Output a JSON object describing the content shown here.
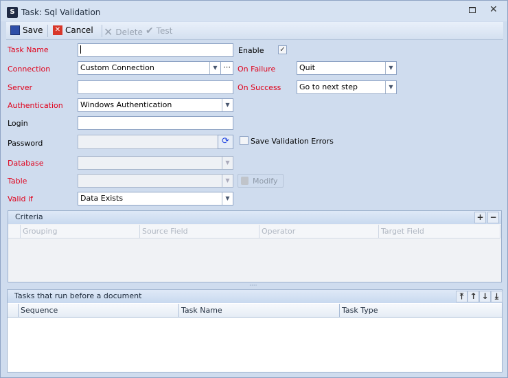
{
  "window": {
    "title": "Task: Sql Validation",
    "icon": "app-logo-icon"
  },
  "toolbar": {
    "save": "Save",
    "cancel": "Cancel",
    "delete": "Delete",
    "test": "Test"
  },
  "form": {
    "task_name_label": "Task Name",
    "task_name_value": "",
    "enable_label": "Enable",
    "enable_checked": true,
    "connection_label": "Connection",
    "connection_value": "Custom Connection",
    "on_failure_label": "On Failure",
    "on_failure_value": "Quit",
    "server_label": "Server",
    "server_value": "",
    "on_success_label": "On Success",
    "on_success_value": "Go to next step",
    "authentication_label": "Authentication",
    "authentication_value": "Windows Authentication",
    "login_label": "Login",
    "login_value": "",
    "password_label": "Password",
    "password_value": "",
    "save_validation_errors_label": "Save Validation Errors",
    "save_validation_errors_checked": false,
    "database_label": "Database",
    "database_value": "",
    "table_label": "Table",
    "table_value": "",
    "modify_label": "Modify",
    "valid_if_label": "Valid if",
    "valid_if_value": "Data Exists"
  },
  "criteria": {
    "title": "Criteria",
    "columns": [
      "Grouping",
      "Source Field",
      "Operator",
      "Target Field"
    ],
    "rows": []
  },
  "tasks": {
    "title": "Tasks that run before a document",
    "columns": [
      "Sequence",
      "Task Name",
      "Task Type"
    ],
    "rows": []
  },
  "colors": {
    "required_label": "#e0001a",
    "background": "#cfdcee"
  }
}
